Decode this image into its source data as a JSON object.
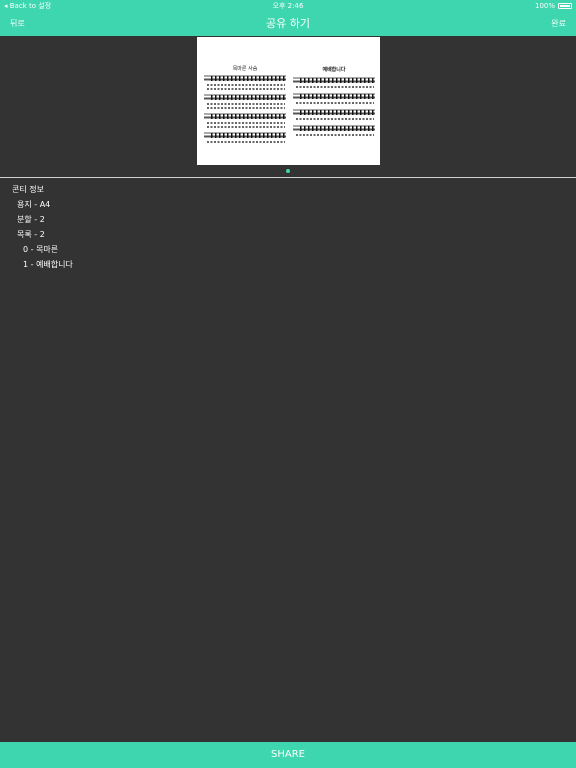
{
  "status_bar": {
    "back_label": "◂ Back to 설정",
    "time": "오후 2:46",
    "battery": "100%"
  },
  "nav": {
    "back": "뒤로",
    "title": "공유 하기",
    "done": "완료"
  },
  "preview": {
    "left_title": "목마른 사슴",
    "right_title": "예배합니다",
    "page_count": 1
  },
  "info": {
    "heading": "콘티 정보",
    "paper": "용지 - A4",
    "split": "분할 - 2",
    "list": "목록 - 2",
    "items": [
      "0 - 목마른",
      "1 - 예배합니다"
    ]
  },
  "share_button": "SHARE",
  "colors": {
    "accent": "#3dd6ae",
    "background": "#333333"
  }
}
